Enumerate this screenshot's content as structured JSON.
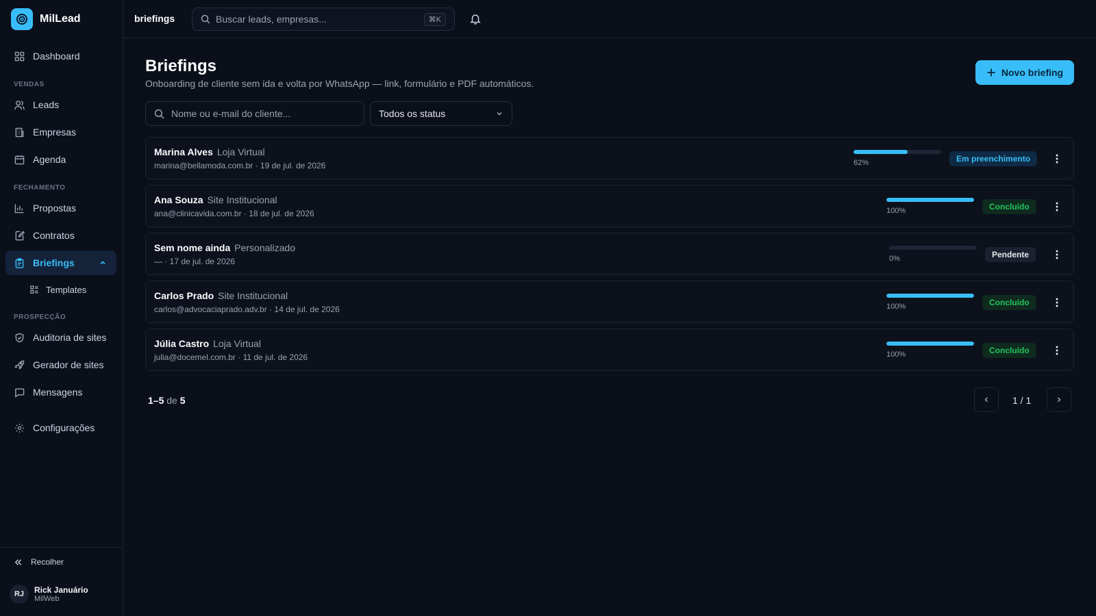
{
  "app": {
    "name": "MilLead"
  },
  "sidebar": {
    "items": {
      "dashboard": "Dashboard",
      "leads": "Leads",
      "empresas": "Empresas",
      "agenda": "Agenda",
      "propostas": "Propostas",
      "contratos": "Contratos",
      "briefings": "Briefings",
      "templates": "Templates",
      "auditoria": "Auditoria de sites",
      "gerador": "Gerador de sites",
      "mensagens": "Mensagens",
      "configuracoes": "Configurações"
    },
    "sections": {
      "vendas": "VENDAS",
      "fechamento": "FECHAMENTO",
      "prospeccao": "PROSPECÇÃO"
    },
    "collapse_label": "Recolher",
    "user": {
      "initials": "RJ",
      "name": "Rick Januário",
      "org": "MilWeb"
    }
  },
  "topbar": {
    "breadcrumb": "briefings",
    "search_placeholder": "Buscar leads, empresas...",
    "shortcut": "⌘K"
  },
  "page": {
    "title": "Briefings",
    "subtitle": "Onboarding de cliente sem ida e volta por WhatsApp — link, formulário e PDF automáticos.",
    "new_button": "Novo briefing",
    "filter_placeholder": "Nome ou e-mail do cliente...",
    "status_filter": "Todos os status"
  },
  "briefings": [
    {
      "name": "Marina Alves",
      "type": "Loja Virtual",
      "email": "marina@bellamoda.com.br",
      "date": "19 de jul. de 2026",
      "progress": 62,
      "progress_label": "62%",
      "status": "Em preenchimento",
      "status_color": "#38bdf8"
    },
    {
      "name": "Ana Souza",
      "type": "Site Institucional",
      "email": "ana@clinicavida.com.br",
      "date": "18 de jul. de 2026",
      "progress": 100,
      "progress_label": "100%",
      "status": "Concluído",
      "status_color": "#22c55e"
    },
    {
      "name": "Sem nome ainda",
      "type": "Personalizado",
      "email": "—",
      "date": "17 de jul. de 2026",
      "progress": 0,
      "progress_label": "0%",
      "status": "Pendente",
      "status_color": "#e5e7eb"
    },
    {
      "name": "Carlos Prado",
      "type": "Site Institucional",
      "email": "carlos@advocaciaprado.adv.br",
      "date": "14 de jul. de 2026",
      "progress": 100,
      "progress_label": "100%",
      "status": "Concluído",
      "status_color": "#22c55e"
    },
    {
      "name": "Júlia Castro",
      "type": "Loja Virtual",
      "email": "julia@docemel.com.br",
      "date": "11 de jul. de 2026",
      "progress": 100,
      "progress_label": "100%",
      "status": "Concluído",
      "status_color": "#22c55e"
    }
  ],
  "pagination": {
    "range": "1–5",
    "of_label": "de",
    "total": "5",
    "page_label": "1 / 1"
  },
  "colors": {
    "accent": "#38bdf8",
    "success": "#22c55e",
    "background": "#0b0f1a"
  }
}
